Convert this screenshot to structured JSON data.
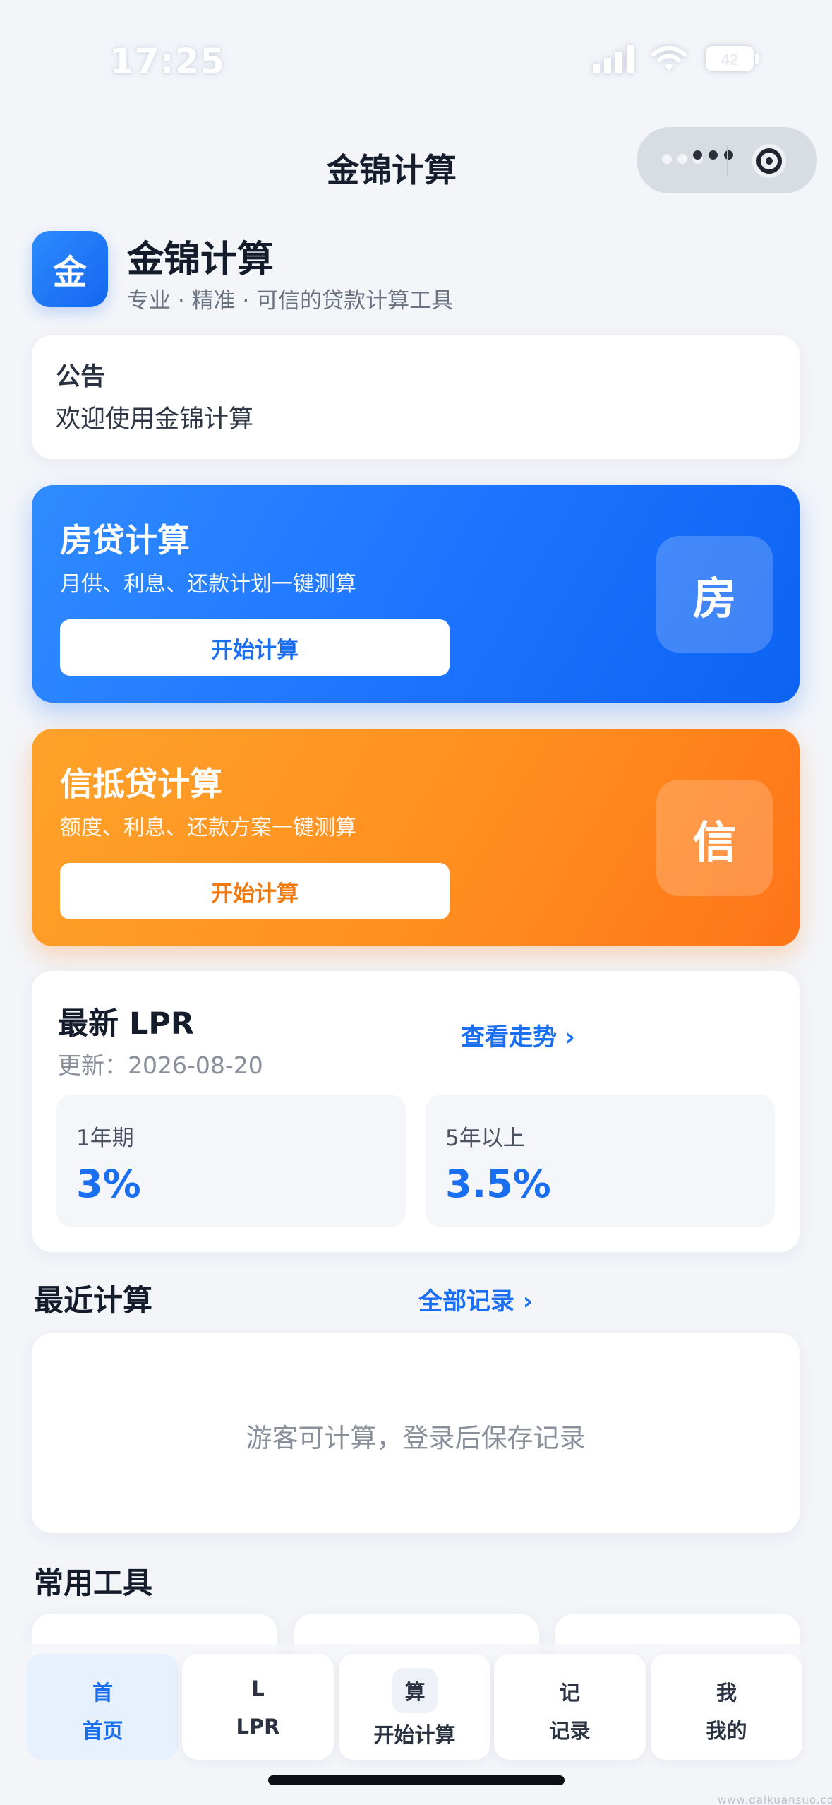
{
  "status_bar": {
    "time": "17:25",
    "battery": "42"
  },
  "nav": {
    "title": "金锦计算"
  },
  "header": {
    "logo_char": "金",
    "app_name": "金锦计算",
    "slogan": "专业 · 精准 · 可信的贷款计算工具"
  },
  "notice": {
    "title": "公告",
    "text": "欢迎使用金锦计算"
  },
  "calculators": [
    {
      "title": "房贷计算",
      "desc": "月供、利息、还款计划一键测算",
      "button": "开始计算",
      "badge": "房",
      "accent": "#1c73ff"
    },
    {
      "title": "信抵贷计算",
      "desc": "额度、利息、还款方案一键测算",
      "button": "开始计算",
      "badge": "信",
      "accent": "#ff8f1f"
    }
  ],
  "lpr": {
    "title": "最新 LPR",
    "updated": "更新：2026-08-20",
    "trend_link": "查看走势 ›",
    "rates": [
      {
        "label": "1年期",
        "value": "3%"
      },
      {
        "label": "5年以上",
        "value": "3.5%"
      }
    ]
  },
  "recent": {
    "title": "最近计算",
    "all_link": "全部记录 ›",
    "empty_text": "游客可计算，登录后保存记录"
  },
  "tools": {
    "title": "常用工具"
  },
  "tab_bar": {
    "items": [
      {
        "icon": "首",
        "label": "首页",
        "active": true
      },
      {
        "icon": "L",
        "label": "LPR",
        "active": false
      },
      {
        "icon": "算",
        "label": "开始计算",
        "active": false
      },
      {
        "icon": "记",
        "label": "记录",
        "active": false
      },
      {
        "icon": "我",
        "label": "我的",
        "active": false
      }
    ]
  },
  "watermark": "www.daikuansuo.com",
  "colors": {
    "primary": "#1a6ff0",
    "orange": "#ff8f1f",
    "background": "#f3f5f9"
  }
}
